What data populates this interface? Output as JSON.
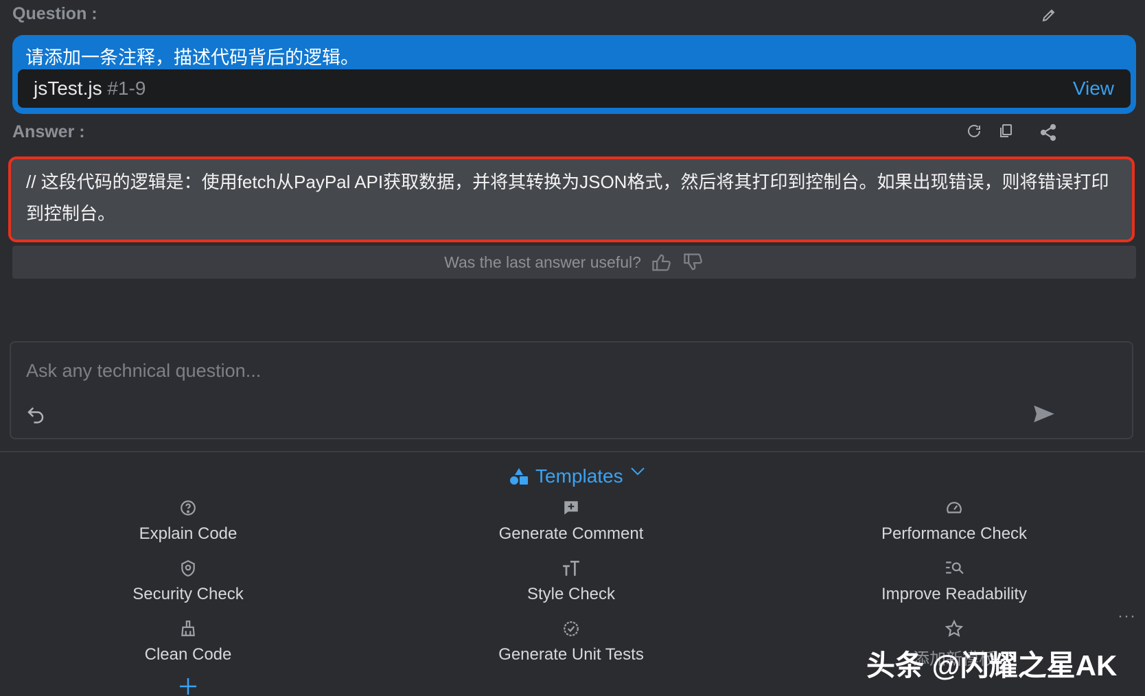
{
  "question": {
    "label": "Question :",
    "text": "请添加一条注释，描述代码背后的逻辑。",
    "code_ref": {
      "file": "jsTest.js",
      "range": "#1-9",
      "view_label": "View"
    }
  },
  "answer": {
    "label": "Answer :",
    "text": "// 这段代码的逻辑是：使用fetch从PayPal API获取数据，并将其转换为JSON格式，然后将其打印到控制台。如果出现错误，则将错误打印到控制台。",
    "feedback_prompt": "Was the last answer useful?"
  },
  "input": {
    "placeholder": "Ask any technical question..."
  },
  "templates": {
    "label": "Templates",
    "items": [
      {
        "label": "Explain Code",
        "icon": "question-circle-icon"
      },
      {
        "label": "Generate Comment",
        "icon": "comment-plus-icon"
      },
      {
        "label": "Performance Check",
        "icon": "gauge-icon"
      },
      {
        "label": "Security Check",
        "icon": "shield-icon"
      },
      {
        "label": "Style Check",
        "icon": "text-size-icon"
      },
      {
        "label": "Improve Readability",
        "icon": "search-list-icon"
      },
      {
        "label": "Clean Code",
        "icon": "broom-icon"
      },
      {
        "label": "Generate Unit Tests",
        "icon": "check-badge-icon"
      },
      {
        "label": "添加新模板",
        "icon": "star-icon"
      }
    ]
  },
  "watermark": "头条 @闪耀之星AK",
  "colors": {
    "accent": "#1177d1",
    "link": "#38a1f1",
    "highlight_border": "#e5321e",
    "background": "#2b2c30"
  }
}
